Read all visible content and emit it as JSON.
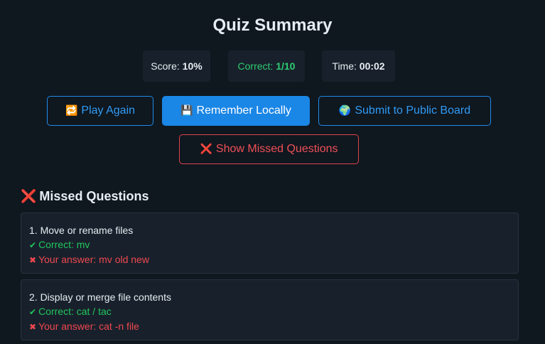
{
  "title": "Quiz Summary",
  "stats": {
    "score_label": "Score:",
    "score_value": "10%",
    "correct_label": "Correct:",
    "correct_value": "1/10",
    "time_label": "Time:",
    "time_value": "00:02"
  },
  "colors": {
    "background": "#0f171f",
    "panel": "#18212b",
    "accent_blue": "#1a86e6",
    "success_green": "#22c55e",
    "error_red": "#ef4750"
  },
  "buttons": {
    "play_again": {
      "icon": "🔁",
      "label": "Play Again"
    },
    "remember_locally": {
      "icon": "💾",
      "label": "Remember Locally"
    },
    "submit_public": {
      "icon": "🌍",
      "label": "Submit to Public Board"
    },
    "show_missed": {
      "icon": "❌",
      "label": "Show Missed Questions"
    }
  },
  "missed": {
    "icon": "❌",
    "title": "Missed Questions",
    "items": [
      {
        "question": "1. Move or rename files",
        "correct_mark": "✔",
        "correct": "Correct: mv",
        "wrong_mark": "✖",
        "answer": "Your answer: mv old new"
      },
      {
        "question": "2. Display or merge file contents",
        "correct_mark": "✔",
        "correct": "Correct: cat / tac",
        "wrong_mark": "✖",
        "answer": "Your answer: cat -n file"
      }
    ]
  }
}
